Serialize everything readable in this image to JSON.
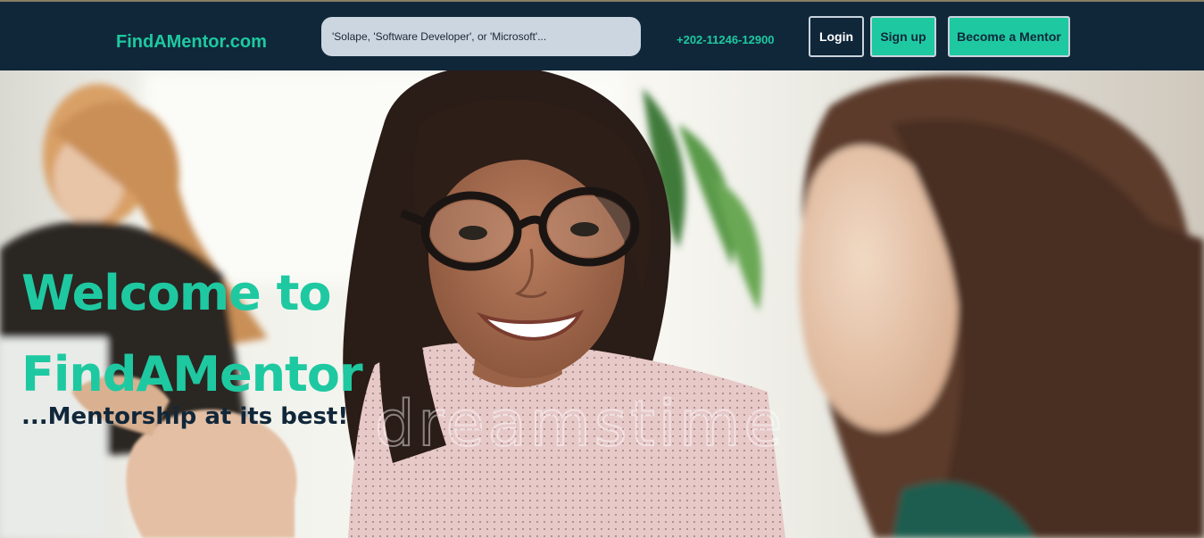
{
  "nav": {
    "brand": "FindAMentor.com",
    "search_placeholder": "'Solape, 'Software Developer', or 'Microsoft'...",
    "phone": "+202-11246-12900",
    "login_label": "Login",
    "signup_label": "Sign up",
    "become_mentor_label": "Become a Mentor"
  },
  "hero": {
    "headline": "Welcome to FindAMentor",
    "tagline": "...Mentorship at its best!",
    "watermark": "dreamstime"
  },
  "colors": {
    "navbar": "#10273a",
    "accent": "#1ec9a1",
    "search_bg": "#cbd6e1",
    "tagline": "#10273a"
  }
}
